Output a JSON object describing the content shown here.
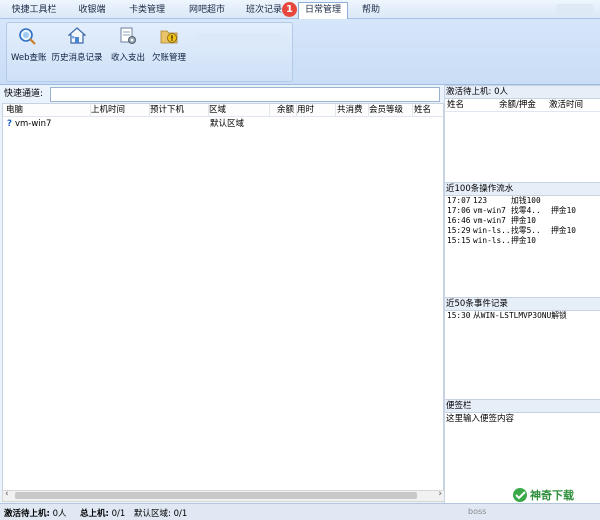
{
  "tabs": [
    {
      "label": "快捷工具栏",
      "active": false
    },
    {
      "label": "收银端",
      "active": false
    },
    {
      "label": "卡类管理",
      "active": false
    },
    {
      "label": "网吧超市",
      "active": false
    },
    {
      "label": "班次记录",
      "active": false
    },
    {
      "label": "日常管理",
      "active": true
    },
    {
      "label": "帮助",
      "active": false
    }
  ],
  "tab_badge": "1",
  "ribbon": {
    "buttons": [
      {
        "label": "Web查账",
        "icon": "magnifier-icon"
      },
      {
        "label": "历史消息记录",
        "icon": "house-icon"
      },
      {
        "label": "收入支出",
        "icon": "document-gear-icon"
      },
      {
        "label": "欠账管理",
        "icon": "folder-warning-icon"
      }
    ]
  },
  "quick": {
    "label": "快速通道:",
    "value": ""
  },
  "table": {
    "columns": [
      "电脑",
      "上机时间",
      "预计下机",
      "区域",
      "余额",
      "用时",
      "共消费",
      "会员等级",
      "姓名"
    ],
    "rows": [
      {
        "computer": "vm-win7",
        "start": "",
        "expected_end": "",
        "area": "默认区域",
        "balance": "",
        "used": "",
        "total": "",
        "level": "",
        "name": ""
      }
    ]
  },
  "activate": {
    "title": "激活待上机: 0人",
    "columns": [
      "姓名",
      "余额/押金",
      "激活时间"
    ]
  },
  "operations": {
    "title": "近100条操作流水",
    "lines": [
      {
        "time": "17:07",
        "who": "123",
        "action": "加钱100"
      },
      {
        "time": "17:06",
        "who": "vm-win7",
        "action": "找零4..",
        "extra": "押金10"
      },
      {
        "time": "16:46",
        "who": "vm-win7",
        "action": "押金10",
        "extra": ""
      },
      {
        "time": "15:29",
        "who": "win-ls..",
        "action": "找零5..",
        "extra": "押金10"
      },
      {
        "time": "15:15",
        "who": "win-ls..",
        "action": "押金10",
        "extra": ""
      }
    ]
  },
  "events": {
    "title": "近50条事件记录",
    "lines": [
      {
        "time": "15:30",
        "text": "从WIN-LSTLMVP3ONU解锁"
      }
    ]
  },
  "memo": {
    "title": "便签栏",
    "placeholder": "这里输入便签内容"
  },
  "status": {
    "activate_label": "激活待上机:",
    "activate_value": "0人",
    "online_label": "总上机:",
    "online_value": "0/1",
    "area_label": "默认区域:",
    "area_value": "0/1",
    "boss": "boss"
  },
  "colors": {
    "accent": "#1a5fc2",
    "badge": "#e8473c",
    "panel_bg": "#eaf2fb"
  }
}
